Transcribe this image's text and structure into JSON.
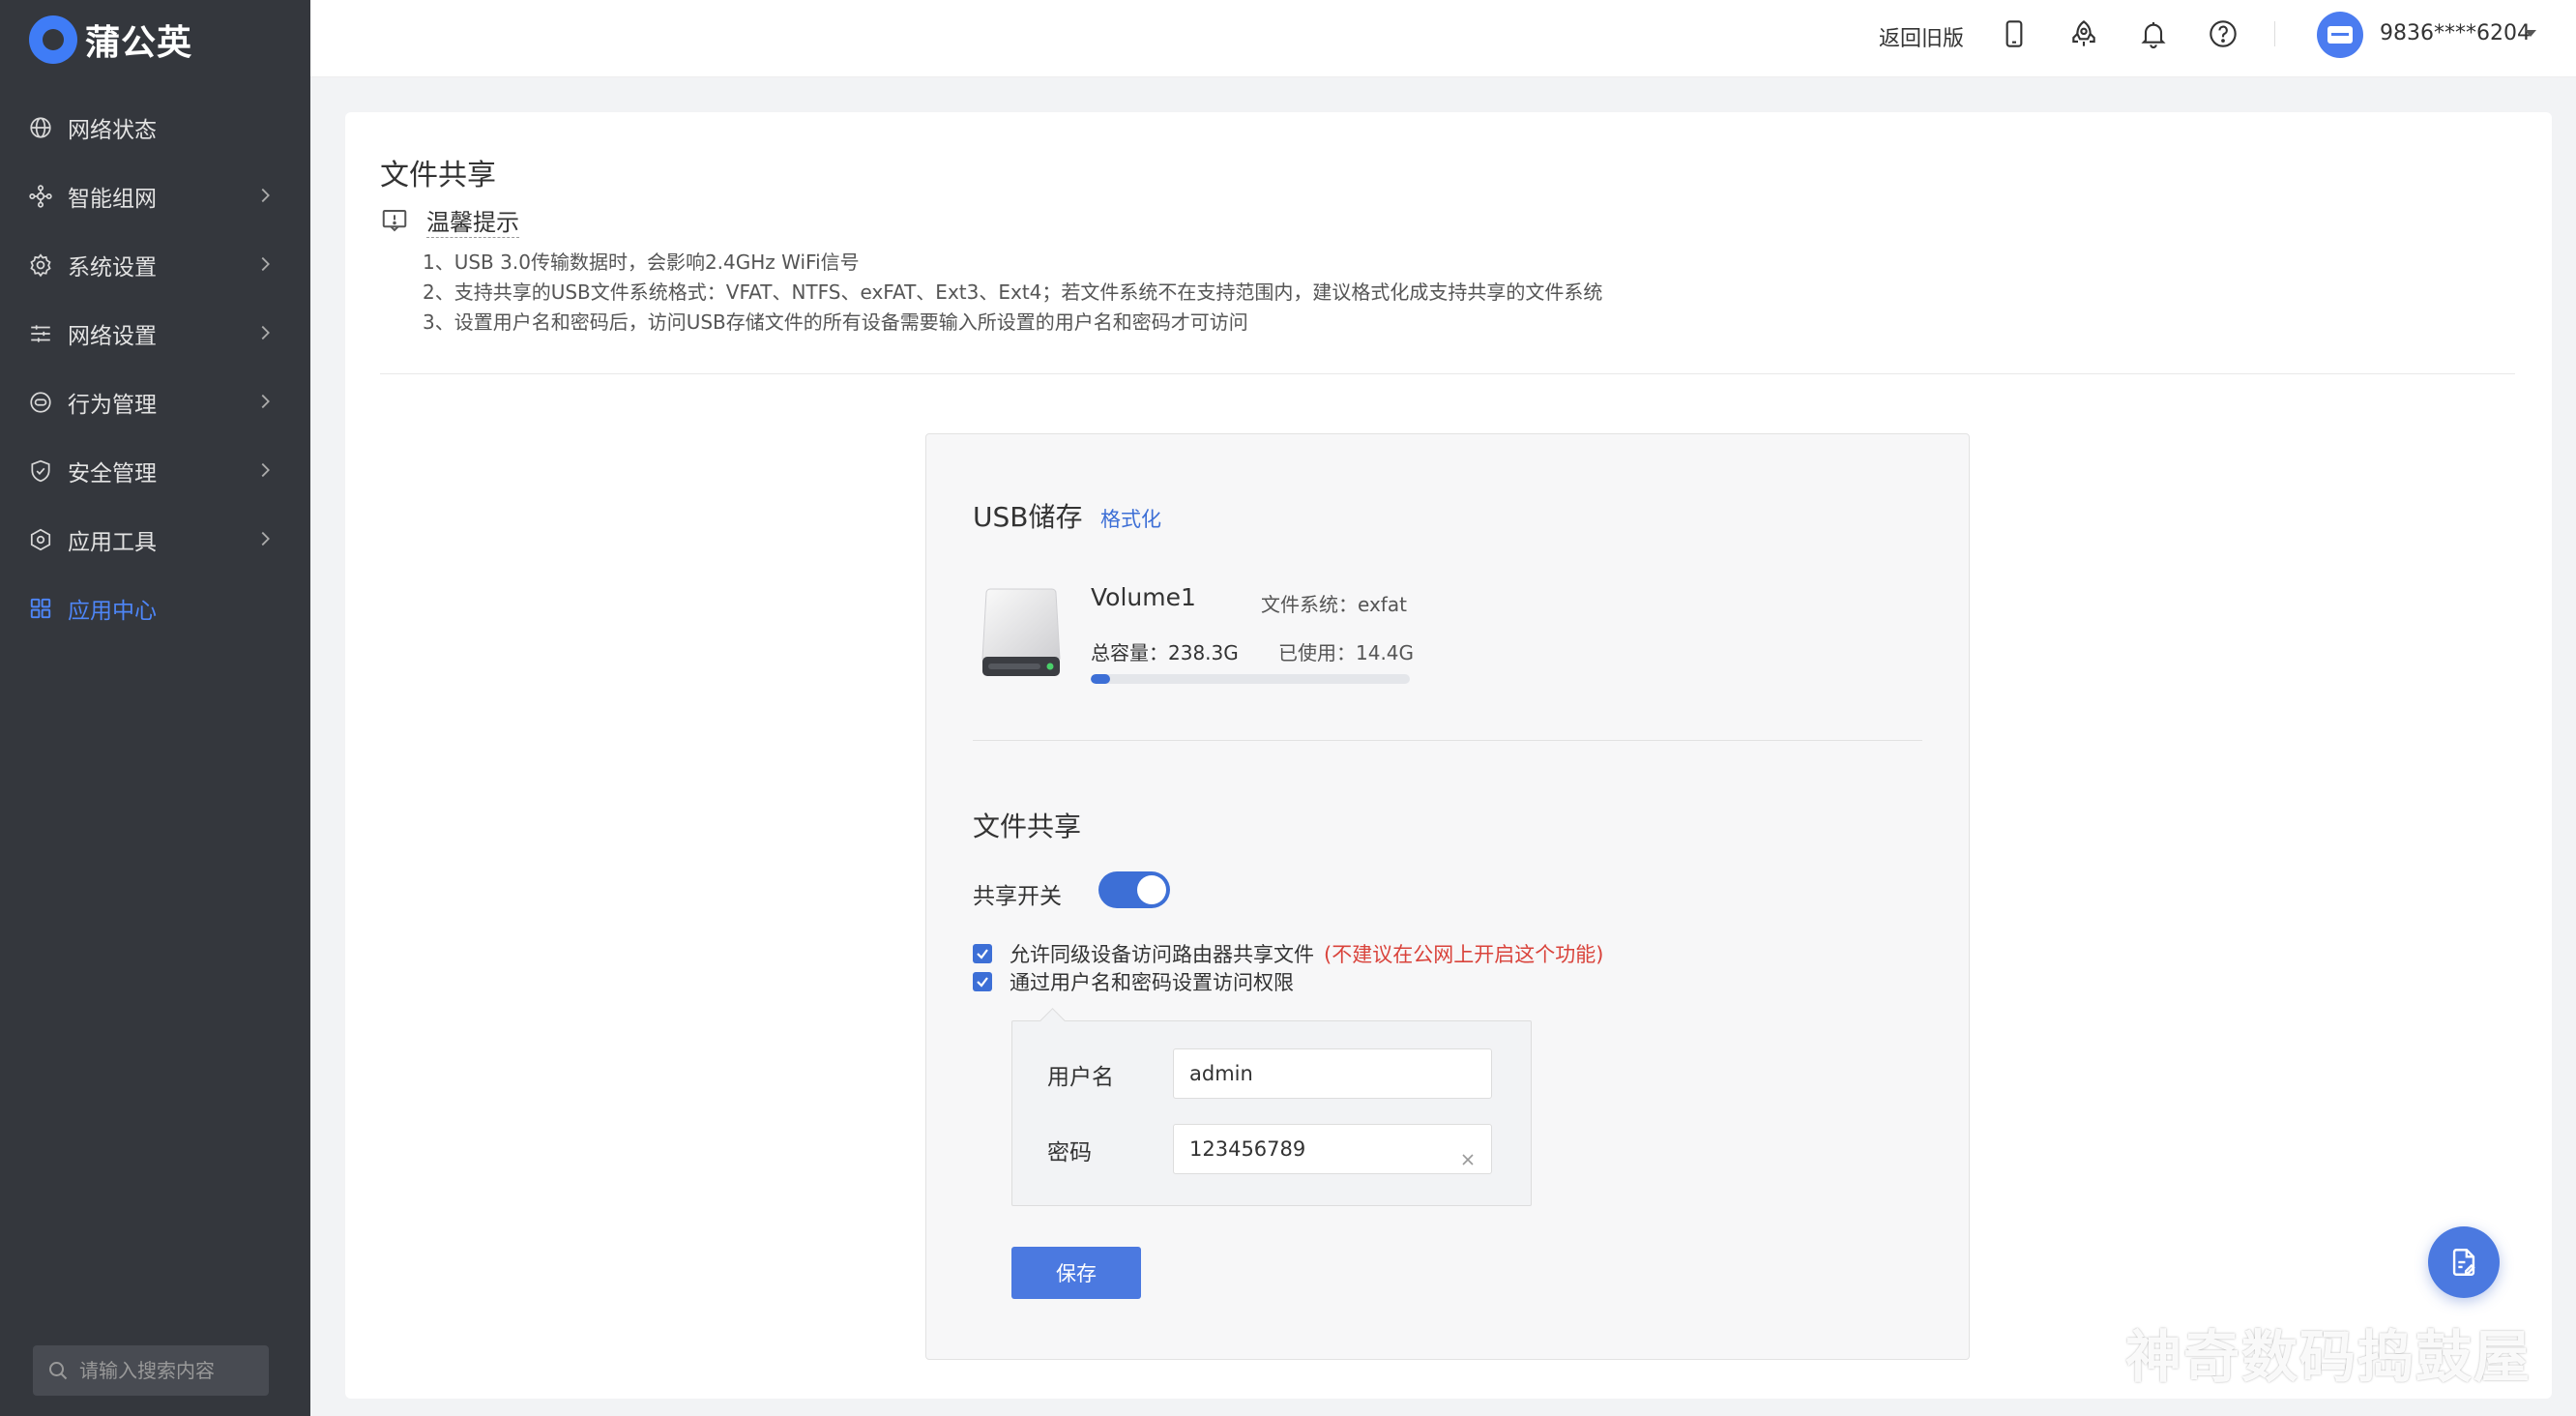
{
  "app": {
    "brand": "蒲公英",
    "accent_color": "#3d6fd6"
  },
  "sidebar": {
    "items": [
      {
        "label": "网络状态",
        "icon": "globe-icon",
        "has_submenu": false,
        "active": false
      },
      {
        "label": "智能组网",
        "icon": "network-icon",
        "has_submenu": true,
        "active": false
      },
      {
        "label": "系统设置",
        "icon": "gear-icon",
        "has_submenu": true,
        "active": false
      },
      {
        "label": "网络设置",
        "icon": "sliders-icon",
        "has_submenu": true,
        "active": false
      },
      {
        "label": "行为管理",
        "icon": "behavior-icon",
        "has_submenu": true,
        "active": false
      },
      {
        "label": "安全管理",
        "icon": "shield-icon",
        "has_submenu": true,
        "active": false
      },
      {
        "label": "应用工具",
        "icon": "hexagon-icon",
        "has_submenu": true,
        "active": false
      },
      {
        "label": "应用中心",
        "icon": "grid-icon",
        "has_submenu": false,
        "active": true
      }
    ],
    "search_placeholder": "请输入搜索内容"
  },
  "header": {
    "old_version_label": "返回旧版",
    "icons": [
      "phone-icon",
      "rocket-icon",
      "bell-icon",
      "help-icon"
    ],
    "user": "9836****6204"
  },
  "page": {
    "title": "文件共享",
    "tip_title": "温馨提示",
    "tips": [
      "1、USB 3.0传输数据时，会影响2.4GHz WiFi信号",
      "2、支持共享的USB文件系统格式：VFAT、NTFS、exFAT、Ext3、Ext4；若文件系统不在支持范围内，建议格式化成支持共享的文件系统",
      "3、设置用户名和密码后，访问USB存储文件的所有设备需要输入所设置的用户名和密码才可访问"
    ]
  },
  "usb": {
    "title": "USB储存",
    "format_link": "格式化",
    "volume_name": "Volume1",
    "filesystem": "文件系统：exfat",
    "total": "总容量：238.3G",
    "used": "已使用：14.4G",
    "used_fraction": 0.06
  },
  "share": {
    "title": "文件共享",
    "switch_label": "共享开关",
    "switch_on": true,
    "option1": "允许同级设备访问路由器共享文件",
    "option1_warning": "(不建议在公网上开启这个功能)",
    "option1_checked": true,
    "option2": "通过用户名和密码设置访问权限",
    "option2_checked": true,
    "username_label": "用户名",
    "username_value": "admin",
    "password_label": "密码",
    "password_value": "123456789",
    "save_label": "保存"
  },
  "watermark": "神奇数码捣鼓屋"
}
